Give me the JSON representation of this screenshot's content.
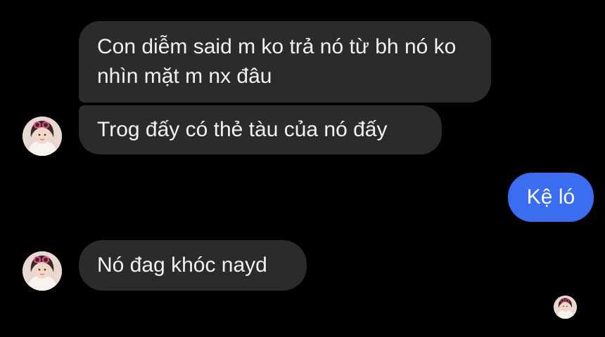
{
  "conversation": {
    "messages": [
      {
        "sender": "other",
        "text": "Con diễm said m ko trả nó từ bh nó ko nhìn mặt m nx đâu"
      },
      {
        "sender": "other",
        "text": "Trog đấy có thẻ tàu của nó đấy"
      },
      {
        "sender": "self",
        "text": "Kệ ló"
      },
      {
        "sender": "other",
        "text": "Nó đag khóc nayd"
      }
    ],
    "colors": {
      "background": "#000000",
      "incoming_bubble": "#2b2b2d",
      "outgoing_bubble": "#3a6df0",
      "text": "#f2f2f2"
    },
    "avatar_icon": "profile-photo-icon"
  }
}
